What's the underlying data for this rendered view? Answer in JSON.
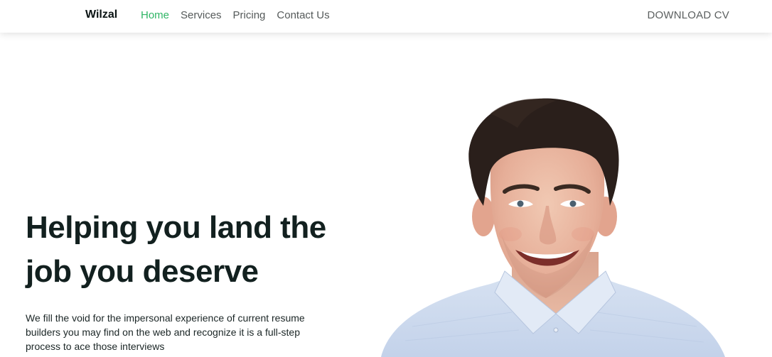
{
  "nav": {
    "brand": "Wilzal",
    "links": [
      {
        "label": "Home",
        "active": true
      },
      {
        "label": "Services",
        "active": false
      },
      {
        "label": "Pricing",
        "active": false
      },
      {
        "label": "Contact Us",
        "active": false
      }
    ],
    "cta": "DOWNLOAD CV"
  },
  "hero": {
    "title_line1": "Helping you land the",
    "title_line2": "job you deserve",
    "description": "We fill the void for the impersonal experience of current resume builders you may find on the web and recognize it is a full-step process to ace those interviews"
  },
  "colors": {
    "accent": "#2fb565",
    "heading": "#12201f",
    "nav_text": "#555a5a"
  }
}
